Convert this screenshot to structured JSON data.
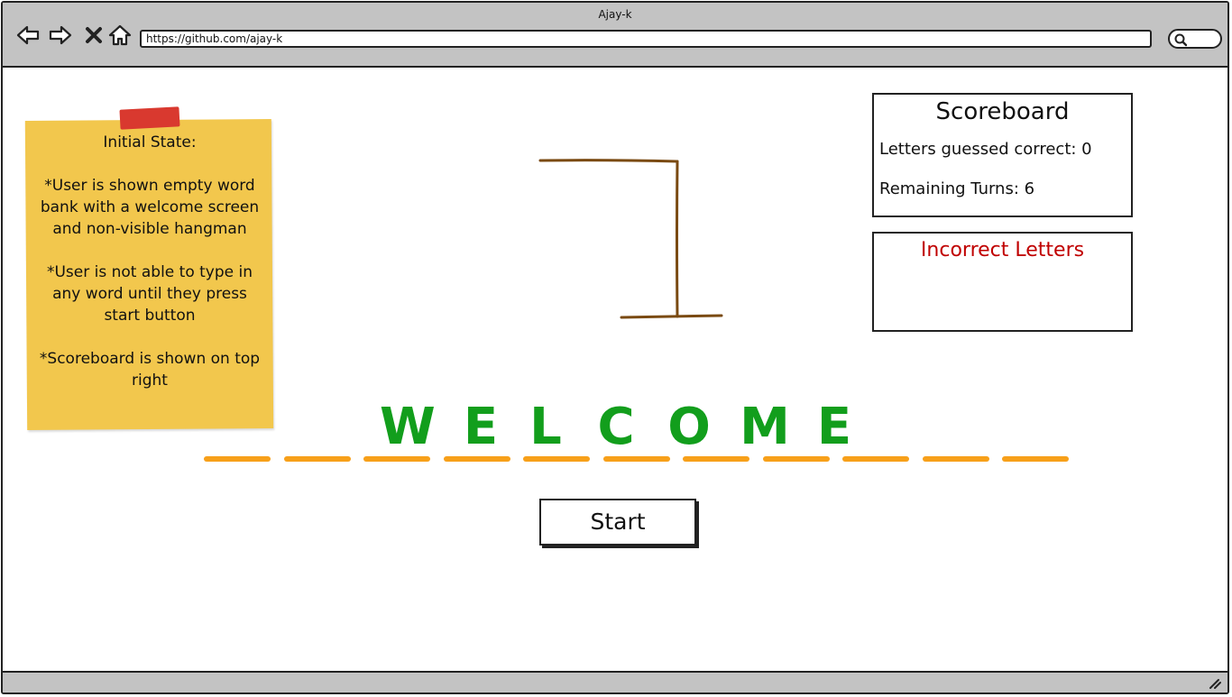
{
  "window": {
    "title": "Ajay-k",
    "url": "https://github.com/ajay-k"
  },
  "toolbar": {
    "icons": [
      "back-arrow-icon",
      "forward-arrow-icon",
      "close-x-icon",
      "home-icon",
      "search-icon"
    ]
  },
  "note": {
    "paragraphs": [
      "Initial State:",
      "*User is shown empty word bank with a welcome screen and non-visible hangman",
      "*User is not able to type in any word until they press start button",
      "*Scoreboard is shown on top right"
    ]
  },
  "scoreboard": {
    "title": "Scoreboard",
    "correct_label": "Letters guessed correct: 0",
    "turns_label": "Remaining Turns: 6"
  },
  "incorrect": {
    "title": "Incorrect Letters"
  },
  "word": {
    "letters": [
      "W",
      "E",
      "L",
      "C",
      "O",
      "M",
      "E"
    ],
    "blank_count": 11
  },
  "start_button": {
    "label": "Start"
  },
  "colors": {
    "chrome": "#c3c3c3",
    "note": "#f2c74d",
    "tape": "#d9392f",
    "welcome": "#129e1c",
    "dash": "#f7a01a",
    "incorrect_title": "#c00000",
    "gallows": "#7a4a12"
  }
}
